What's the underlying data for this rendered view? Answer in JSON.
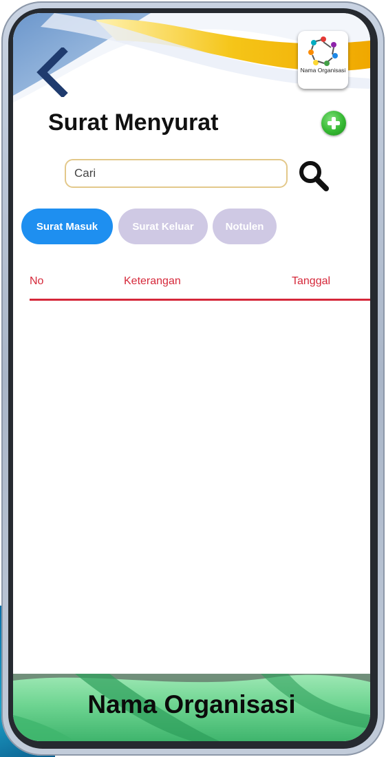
{
  "header": {
    "back_icon": "chevron-left-icon",
    "org_logo_text": "Nama Organisasi"
  },
  "page": {
    "title": "Surat Menyurat",
    "add_icon": "plus-circle-icon"
  },
  "search": {
    "placeholder": "Cari",
    "value": "",
    "icon": "search-icon"
  },
  "tabs": [
    {
      "label": "Surat Masuk",
      "active": true
    },
    {
      "label": "Surat Keluar",
      "active": false
    },
    {
      "label": "Notulen",
      "active": false
    }
  ],
  "table": {
    "columns": [
      "No",
      "Keterangan",
      "Tanggal"
    ],
    "rows": []
  },
  "footer": {
    "text": "Nama Organisasi"
  },
  "colors": {
    "tab_active": "#1e8ff0",
    "tab_inactive": "#cfc9e4",
    "table_header": "#d5283a",
    "add_button": "#35b832",
    "footer": "#6fd592"
  }
}
